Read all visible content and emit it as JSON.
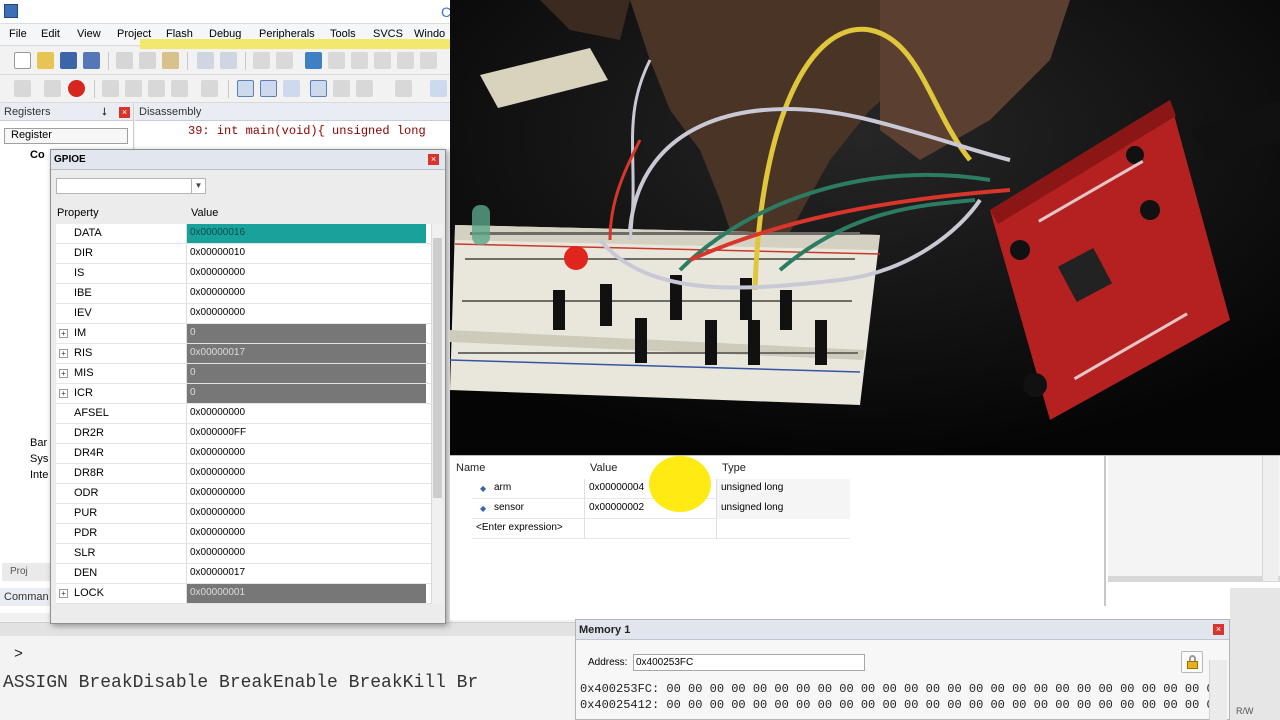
{
  "ide": {
    "title_letter": "C",
    "menu": [
      "File",
      "Edit",
      "View",
      "Project",
      "Flash",
      "Debug",
      "Peripherals",
      "Tools",
      "SVCS",
      "Windo"
    ],
    "registers_panel": {
      "title": "Registers",
      "combo": "Register",
      "tree_items": [
        "Co",
        "Bar",
        "Sys",
        "Inte"
      ],
      "tab": "Proj"
    },
    "disassembly": {
      "title": "Disassembly",
      "line": "39: int main(void){ unsigned long"
    },
    "gpioe": {
      "title": "GPIOE",
      "header_property": "Property",
      "header_value": "Value",
      "rows": [
        {
          "name": "DATA",
          "value": "0x00000016",
          "style": "sel",
          "expand": false
        },
        {
          "name": "DIR",
          "value": "0x00000010",
          "style": "",
          "expand": false
        },
        {
          "name": "IS",
          "value": "0x00000000",
          "style": "",
          "expand": false
        },
        {
          "name": "IBE",
          "value": "0x00000000",
          "style": "",
          "expand": false
        },
        {
          "name": "IEV",
          "value": "0x00000000",
          "style": "",
          "expand": false
        },
        {
          "name": "IM",
          "value": "0",
          "style": "dark",
          "expand": true
        },
        {
          "name": "RIS",
          "value": "0x00000017",
          "style": "dark",
          "expand": true
        },
        {
          "name": "MIS",
          "value": "0",
          "style": "dark",
          "expand": true
        },
        {
          "name": "ICR",
          "value": "0",
          "style": "dark",
          "expand": true
        },
        {
          "name": "AFSEL",
          "value": "0x00000000",
          "style": "",
          "expand": false
        },
        {
          "name": "DR2R",
          "value": "0x000000FF",
          "style": "",
          "expand": false
        },
        {
          "name": "DR4R",
          "value": "0x00000000",
          "style": "",
          "expand": false
        },
        {
          "name": "DR8R",
          "value": "0x00000000",
          "style": "",
          "expand": false
        },
        {
          "name": "ODR",
          "value": "0x00000000",
          "style": "",
          "expand": false
        },
        {
          "name": "PUR",
          "value": "0x00000000",
          "style": "",
          "expand": false
        },
        {
          "name": "PDR",
          "value": "0x00000000",
          "style": "",
          "expand": false
        },
        {
          "name": "SLR",
          "value": "0x00000000",
          "style": "",
          "expand": false
        },
        {
          "name": "DEN",
          "value": "0x00000017",
          "style": "",
          "expand": false
        },
        {
          "name": "LOCK",
          "value": "0x00000001",
          "style": "dark",
          "expand": true
        }
      ]
    },
    "command": {
      "title": "Comman",
      "prompt": ">",
      "assign_line": "ASSIGN BreakDisable BreakEnable BreakKill Br"
    }
  },
  "watch": {
    "headers": {
      "name": "Name",
      "value": "Value",
      "type": "Type"
    },
    "rows": [
      {
        "name": "arm",
        "value": "0x00000004",
        "type": "unsigned long"
      },
      {
        "name": "sensor",
        "value": "0x00000002",
        "type": "unsigned long"
      }
    ],
    "enter_expression": "<Enter expression>"
  },
  "memory": {
    "title": "Memory 1",
    "address_label": "Address:",
    "address_value": "0x400253FC",
    "lines": [
      "0x400253FC: 00 00 00 00 00 00 00 00 00 00 00 00 00 00 00 00 00 00 00 00 00 00 00 00 00 00",
      "0x40025412: 00 00 00 00 00 00 00 00 00 00 00 00 00 00 00 00 00 00 00 00 00 00 00 00 00 00"
    ]
  },
  "status": {
    "rw": "R/W"
  },
  "colors": {
    "selected_value_bg": "#18a29b",
    "dark_value_bg": "#777777",
    "highlight": "#ffe800",
    "close_red": "#d9342b"
  }
}
